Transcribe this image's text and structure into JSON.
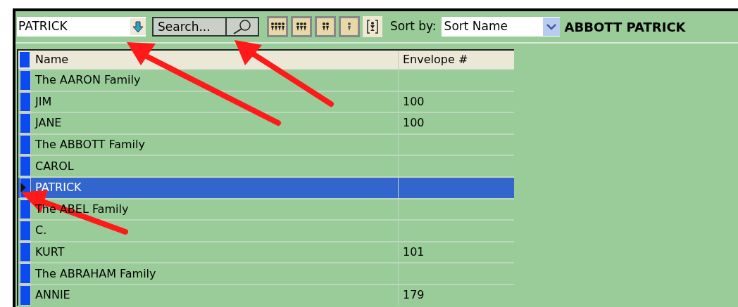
{
  "toolbar": {
    "name_field": {
      "value": "PATRICK"
    },
    "search_button": "Search...",
    "sort_label": "Sort by:",
    "sort_select": {
      "value": "Sort Name"
    },
    "current_name": "ABBOTT PATRICK"
  },
  "table": {
    "columns": [
      "Name",
      "Envelope #"
    ],
    "rows": [
      {
        "name": "The AARON Family",
        "envelope": "",
        "selected": false
      },
      {
        "name": "JIM",
        "envelope": "100",
        "selected": false
      },
      {
        "name": "JANE",
        "envelope": "100",
        "selected": false
      },
      {
        "name": "The ABBOTT Family",
        "envelope": "",
        "selected": false
      },
      {
        "name": "CAROL",
        "envelope": "",
        "selected": false
      },
      {
        "name": "PATRICK",
        "envelope": "",
        "selected": true
      },
      {
        "name": "The ABEL Family",
        "envelope": "",
        "selected": false
      },
      {
        "name": "C.",
        "envelope": "",
        "selected": false
      },
      {
        "name": "KURT",
        "envelope": "101",
        "selected": false
      },
      {
        "name": "The ABRAHAM Family",
        "envelope": "",
        "selected": false
      },
      {
        "name": "ANNIE",
        "envelope": "179",
        "selected": false
      }
    ]
  }
}
